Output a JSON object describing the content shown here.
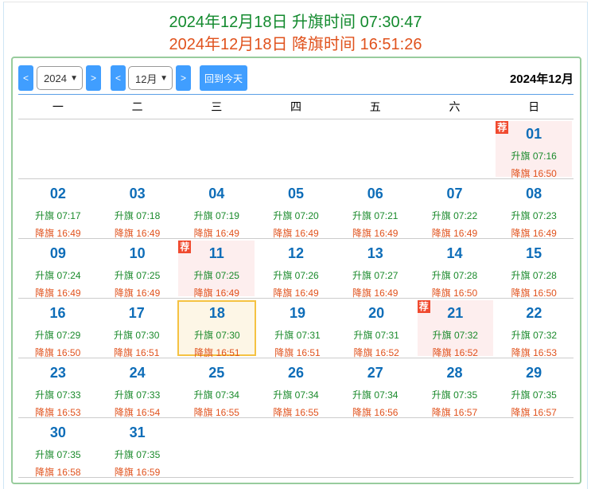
{
  "header": {
    "sunrise_line": "2024年12月18日 升旗时间 07:30:47",
    "sunset_line": "2024年12月18日 降旗时间 16:51:26"
  },
  "toolbar": {
    "prev": "<",
    "next": ">",
    "year": "2024",
    "month": "12月",
    "today_button": "回到今天",
    "title": "2024年12月"
  },
  "weekdays": [
    "一",
    "二",
    "三",
    "四",
    "五",
    "六",
    "日"
  ],
  "labels": {
    "rise": "升旗",
    "set": "降旗",
    "recommend": "荐"
  },
  "first_weekday_index": 6,
  "days": [
    {
      "d": "01",
      "r": "07:16",
      "s": "16:50",
      "rec": true
    },
    {
      "d": "02",
      "r": "07:17",
      "s": "16:49"
    },
    {
      "d": "03",
      "r": "07:18",
      "s": "16:49"
    },
    {
      "d": "04",
      "r": "07:19",
      "s": "16:49"
    },
    {
      "d": "05",
      "r": "07:20",
      "s": "16:49"
    },
    {
      "d": "06",
      "r": "07:21",
      "s": "16:49"
    },
    {
      "d": "07",
      "r": "07:22",
      "s": "16:49"
    },
    {
      "d": "08",
      "r": "07:23",
      "s": "16:49"
    },
    {
      "d": "09",
      "r": "07:24",
      "s": "16:49"
    },
    {
      "d": "10",
      "r": "07:25",
      "s": "16:49"
    },
    {
      "d": "11",
      "r": "07:25",
      "s": "16:49",
      "rec": true
    },
    {
      "d": "12",
      "r": "07:26",
      "s": "16:49"
    },
    {
      "d": "13",
      "r": "07:27",
      "s": "16:49"
    },
    {
      "d": "14",
      "r": "07:28",
      "s": "16:50"
    },
    {
      "d": "15",
      "r": "07:28",
      "s": "16:50"
    },
    {
      "d": "16",
      "r": "07:29",
      "s": "16:50"
    },
    {
      "d": "17",
      "r": "07:30",
      "s": "16:51"
    },
    {
      "d": "18",
      "r": "07:30",
      "s": "16:51",
      "today": true
    },
    {
      "d": "19",
      "r": "07:31",
      "s": "16:51"
    },
    {
      "d": "20",
      "r": "07:31",
      "s": "16:52"
    },
    {
      "d": "21",
      "r": "07:32",
      "s": "16:52",
      "rec": true
    },
    {
      "d": "22",
      "r": "07:32",
      "s": "16:53"
    },
    {
      "d": "23",
      "r": "07:33",
      "s": "16:53"
    },
    {
      "d": "24",
      "r": "07:33",
      "s": "16:54"
    },
    {
      "d": "25",
      "r": "07:34",
      "s": "16:55"
    },
    {
      "d": "26",
      "r": "07:34",
      "s": "16:55"
    },
    {
      "d": "27",
      "r": "07:34",
      "s": "16:56"
    },
    {
      "d": "28",
      "r": "07:35",
      "s": "16:57"
    },
    {
      "d": "29",
      "r": "07:35",
      "s": "16:57"
    },
    {
      "d": "30",
      "r": "07:35",
      "s": "16:58"
    },
    {
      "d": "31",
      "r": "07:35",
      "s": "16:59"
    }
  ]
}
